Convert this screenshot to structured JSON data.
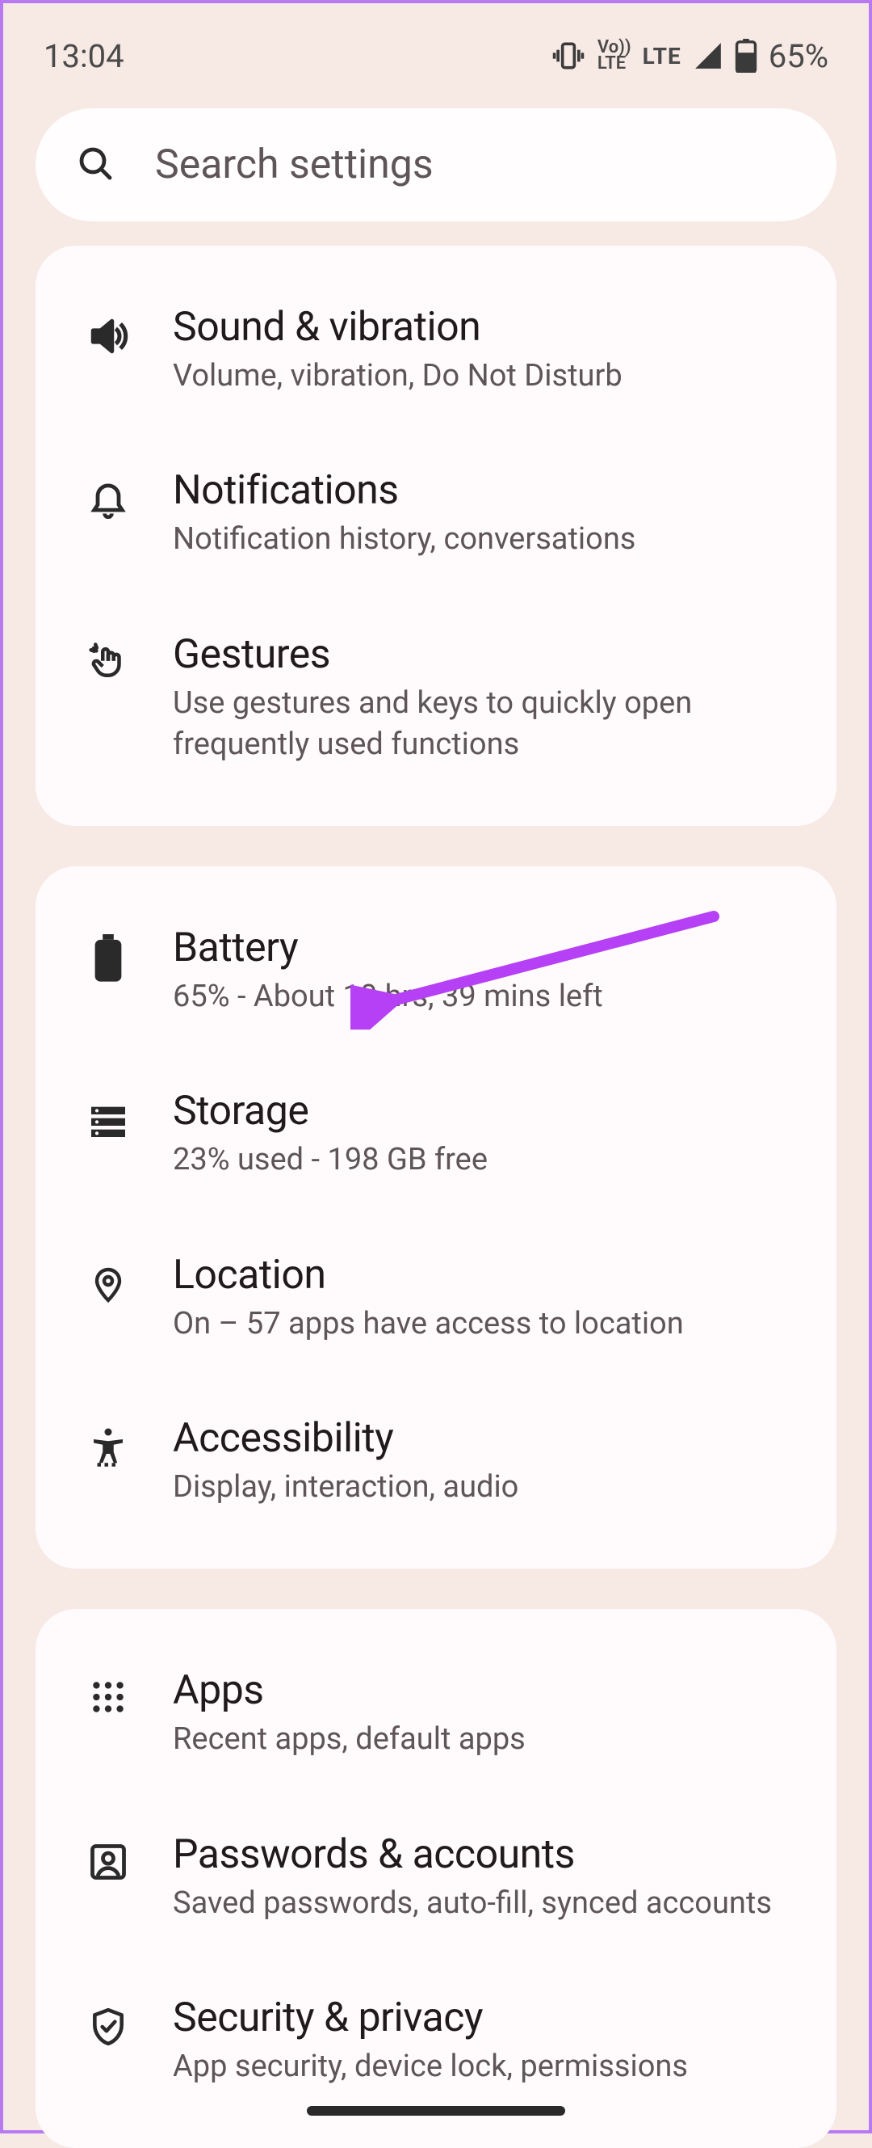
{
  "status_bar": {
    "time": "13:04",
    "volte_top": "Vo))",
    "volte_bottom": "LTE",
    "network_label": "LTE",
    "battery_percent": "65%"
  },
  "search": {
    "placeholder": "Search settings"
  },
  "groups": [
    {
      "items": [
        {
          "key": "sound",
          "icon": "volume-icon",
          "title": "Sound & vibration",
          "subtitle": "Volume, vibration, Do Not Disturb"
        },
        {
          "key": "notifications",
          "icon": "bell-icon",
          "title": "Notifications",
          "subtitle": "Notification history, conversations"
        },
        {
          "key": "gestures",
          "icon": "gesture-icon",
          "title": "Gestures",
          "subtitle": "Use gestures and keys to quickly open frequently used functions"
        }
      ]
    },
    {
      "items": [
        {
          "key": "battery",
          "icon": "battery-icon",
          "title": "Battery",
          "subtitle": "65% - About 10 hrs, 39 mins left"
        },
        {
          "key": "storage",
          "icon": "storage-icon",
          "title": "Storage",
          "subtitle": "23% used - 198 GB free"
        },
        {
          "key": "location",
          "icon": "location-icon",
          "title": "Location",
          "subtitle": "On – 57 apps have access to location"
        },
        {
          "key": "accessibility",
          "icon": "accessibility-icon",
          "title": "Accessibility",
          "subtitle": "Display, interaction, audio"
        }
      ]
    },
    {
      "items": [
        {
          "key": "apps",
          "icon": "apps-icon",
          "title": "Apps",
          "subtitle": "Recent apps, default apps"
        },
        {
          "key": "passwords",
          "icon": "account-icon",
          "title": "Passwords & accounts",
          "subtitle": "Saved passwords, auto-fill, synced accounts"
        },
        {
          "key": "security",
          "icon": "shield-icon",
          "title": "Security & privacy",
          "subtitle": "App security, device lock, permissions"
        }
      ]
    }
  ],
  "annotation": {
    "target": "battery",
    "color": "#b640f5"
  }
}
